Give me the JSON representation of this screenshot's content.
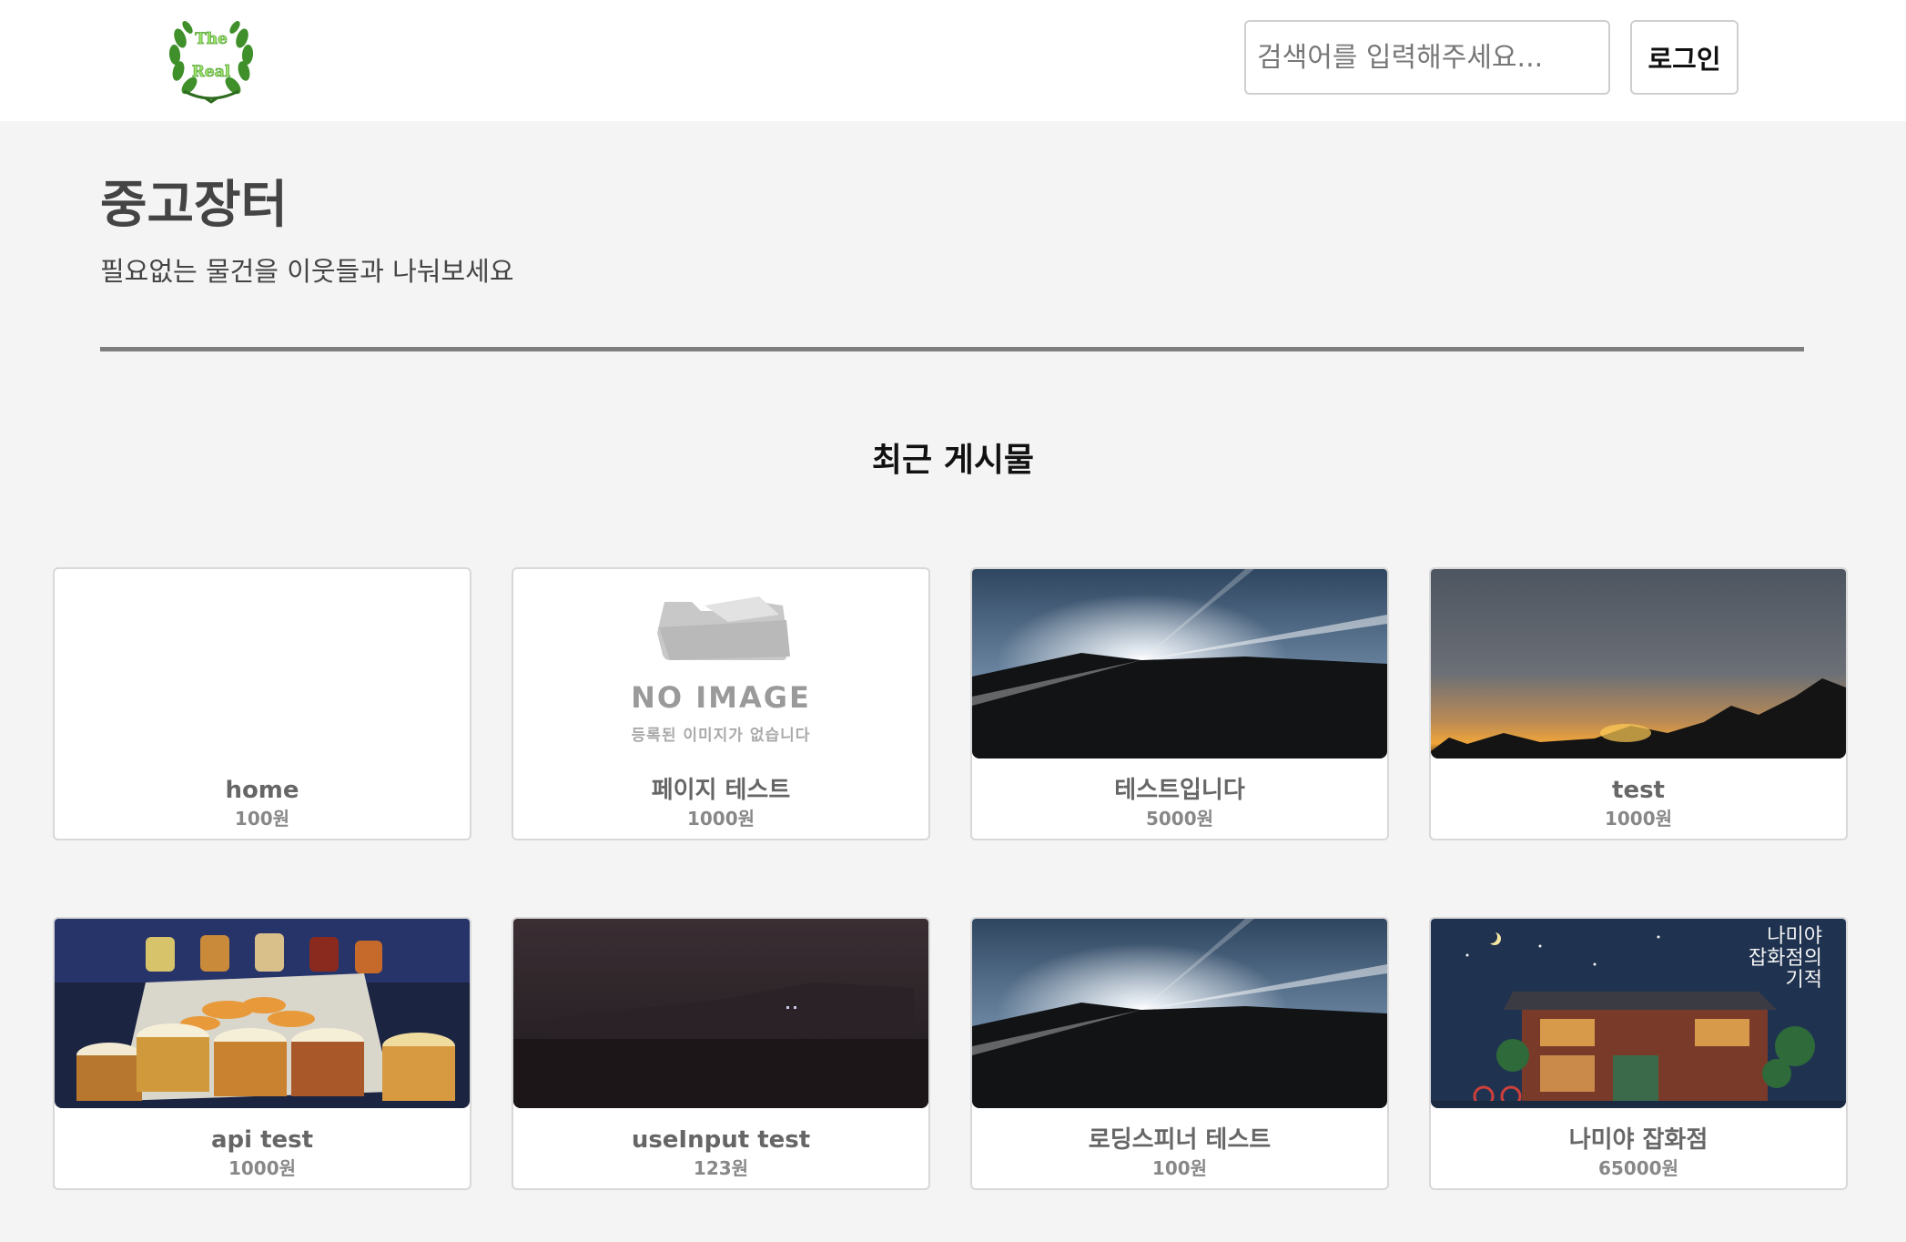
{
  "header": {
    "logo_text_top": "The",
    "logo_text_bottom": "Real",
    "search_placeholder": "검색어를 입력해주세요...",
    "login_label": "로그인"
  },
  "hero": {
    "title": "중고장터",
    "subtitle": "필요없는 물건을 이웃들과 나눠보세요"
  },
  "section_title": "최근 게시물",
  "posts": [
    {
      "name": "home",
      "price": "100원",
      "image": "none"
    },
    {
      "name": "페이지 테스트",
      "price": "1000원",
      "image": "no-image-placeholder",
      "no_image_text": "NO IMAGE",
      "no_image_sub": "등록된 이미지가 없습니다"
    },
    {
      "name": "테스트입니다",
      "price": "5000원",
      "image": "sunburst-photo"
    },
    {
      "name": "test",
      "price": "1000원",
      "image": "sunset-photo"
    },
    {
      "name": "api test",
      "price": "1000원",
      "image": "beer-flight-photo"
    },
    {
      "name": "useInput test",
      "price": "123원",
      "image": "night-building-photo"
    },
    {
      "name": "로딩스피너 테스트",
      "price": "100원",
      "image": "sunburst-photo"
    },
    {
      "name": "나미야 잡화점",
      "price": "65000원",
      "image": "book-cover-photo",
      "cover_text_1": "나미야",
      "cover_text_2": "잡화점의",
      "cover_text_3": "기적"
    }
  ],
  "colors": {
    "page_bg": "#f4f4f4",
    "header_bg": "#ffffff",
    "divider": "#7e7e7e",
    "logo_green": "#3f8f2a",
    "logo_text": "#9be36a"
  }
}
